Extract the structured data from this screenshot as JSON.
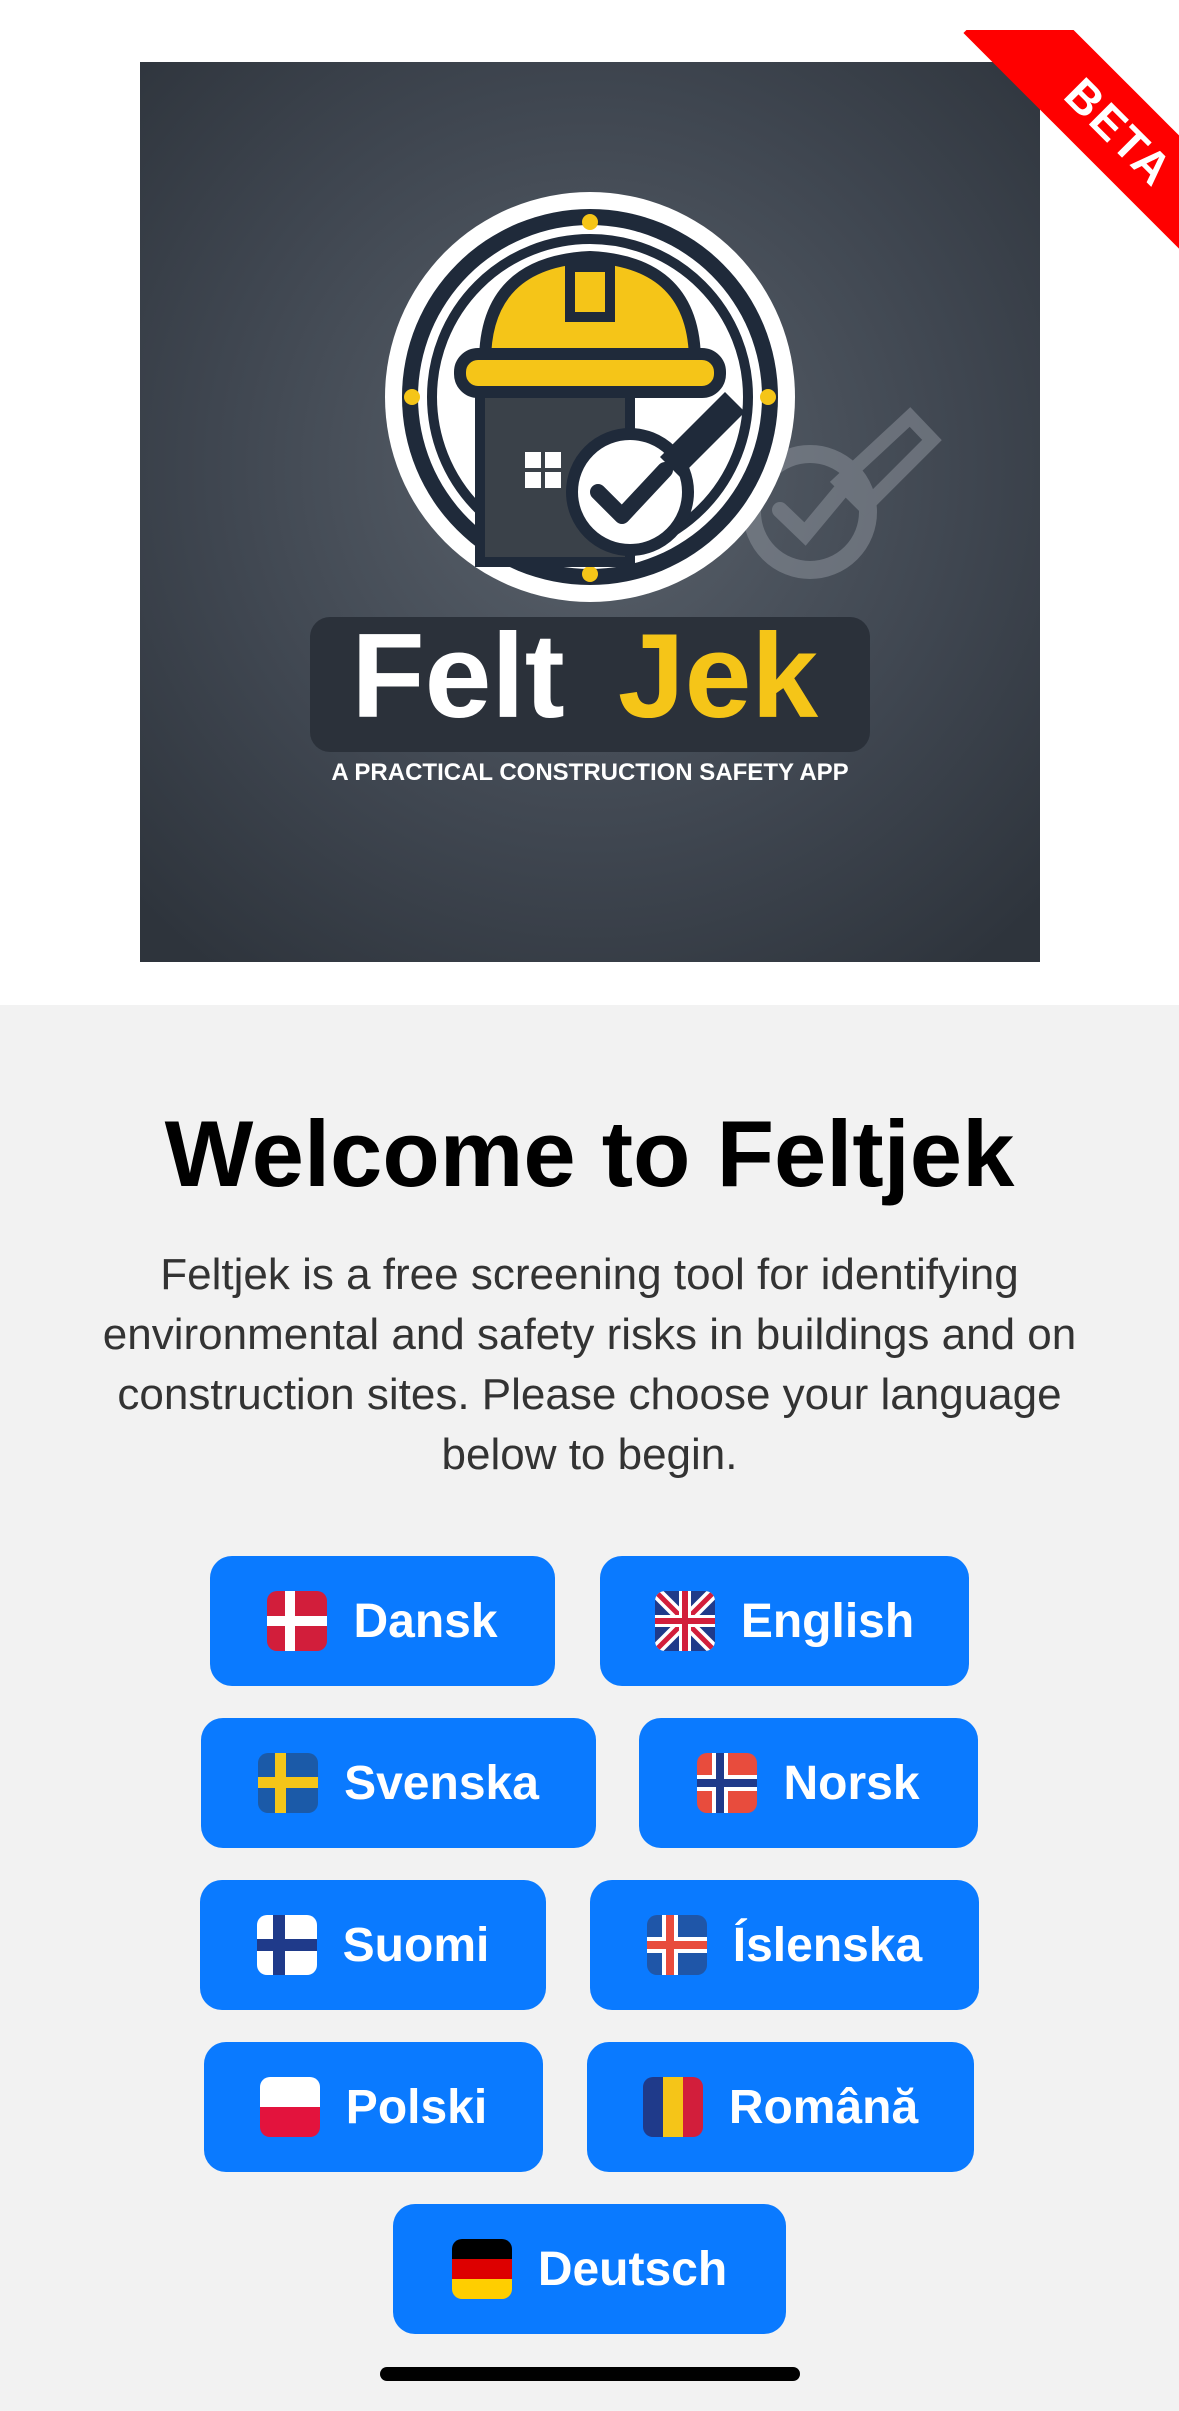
{
  "app": {
    "badge": "BETA",
    "logo": {
      "brand_part1": "Felt",
      "brand_part2": "Jek",
      "tagline": "A PRACTICAL CONSTRUCTION SAFETY APP"
    }
  },
  "welcome": {
    "title": "Welcome to Feltjek",
    "description": "Feltjek is a free screening tool for identifying environmental and safety risks in buildings and on construction sites. Please choose your language below to begin."
  },
  "languages": [
    {
      "label": "Dansk",
      "flag": "denmark-flag-icon"
    },
    {
      "label": "English",
      "flag": "uk-flag-icon"
    },
    {
      "label": "Svenska",
      "flag": "sweden-flag-icon"
    },
    {
      "label": "Norsk",
      "flag": "norway-flag-icon"
    },
    {
      "label": "Suomi",
      "flag": "finland-flag-icon"
    },
    {
      "label": "Íslenska",
      "flag": "iceland-flag-icon"
    },
    {
      "label": "Polski",
      "flag": "poland-flag-icon"
    },
    {
      "label": "Română",
      "flag": "romania-flag-icon"
    },
    {
      "label": "Deutsch",
      "flag": "germany-flag-icon"
    }
  ],
  "colors": {
    "accent": "#0a7aff",
    "badge": "#ff0000",
    "content_bg": "#f2f2f2",
    "logo_bg": "#3a4149",
    "logo_yellow": "#f5c518"
  }
}
